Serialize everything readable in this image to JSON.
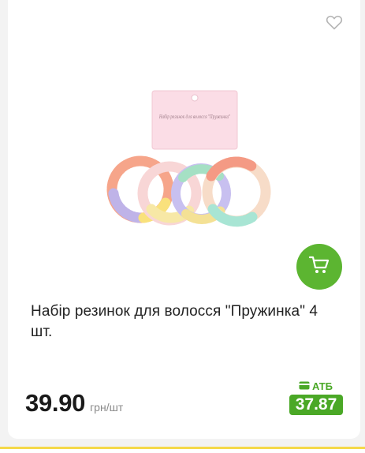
{
  "product": {
    "title": "Набір резинок для волосся \"Пружинка\" 4 шт.",
    "price": "39.90",
    "unit": "грн/шт",
    "atb_label": "АТБ",
    "atb_price": "37.87",
    "package_text": "Набір резинок для волосся \"Пружинка\""
  },
  "icons": {
    "favorite": "heart-outline-icon",
    "cart": "shopping-cart-icon",
    "card": "card-icon"
  },
  "colors": {
    "accent_green": "#5cb531",
    "atb_green": "#4aa826",
    "bottom_strip": "#f5d94a"
  }
}
